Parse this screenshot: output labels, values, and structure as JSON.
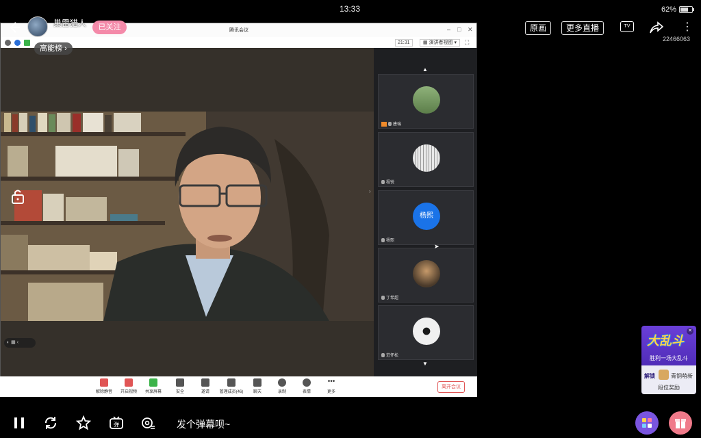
{
  "status": {
    "time": "13:33",
    "battery": "62%"
  },
  "streamer": {
    "name": "巢雷猎人",
    "follow_label": "已关注",
    "rank_label": "高能榜",
    "rank_chevron": "›"
  },
  "top_right": {
    "original_label": "原画",
    "more_live_label": "更多直播",
    "tv_label": "TV",
    "room_id": "22466063"
  },
  "meeting": {
    "window_title": "腾讯会议",
    "timer": "21:31",
    "view_label": "演讲者视图",
    "tiles": [
      {
        "name": "唐瑞"
      },
      {
        "name": "程锐"
      },
      {
        "name": "杨熙",
        "initials": "杨熙"
      },
      {
        "name": "丁希超"
      },
      {
        "name": "范怀松"
      }
    ],
    "toolbar": [
      {
        "label": "解除静音"
      },
      {
        "label": "开启视频"
      },
      {
        "label": "共享屏幕"
      },
      {
        "label": "安全"
      },
      {
        "label": "邀请"
      },
      {
        "label": "管理成员(46)"
      },
      {
        "label": "聊天"
      },
      {
        "label": "录制"
      },
      {
        "label": "表情"
      },
      {
        "label": "更多"
      }
    ],
    "leave_label": "离开会议",
    "mini_ctrl": "◐ ▦ ‹"
  },
  "ad": {
    "logo": "大乱斗",
    "subtitle": "胜利一场大乱斗",
    "unlock": "解锁",
    "rank": "青铜萌新",
    "reward": "段位奖励"
  },
  "player": {
    "danmu_placeholder": "发个弹幕呗~"
  },
  "colors": {
    "follow_pink": "#f48aa9",
    "leave_red": "#e05555",
    "tile_avatar_blue": "#1a73e8",
    "ad_purple": "#5a30c8"
  }
}
